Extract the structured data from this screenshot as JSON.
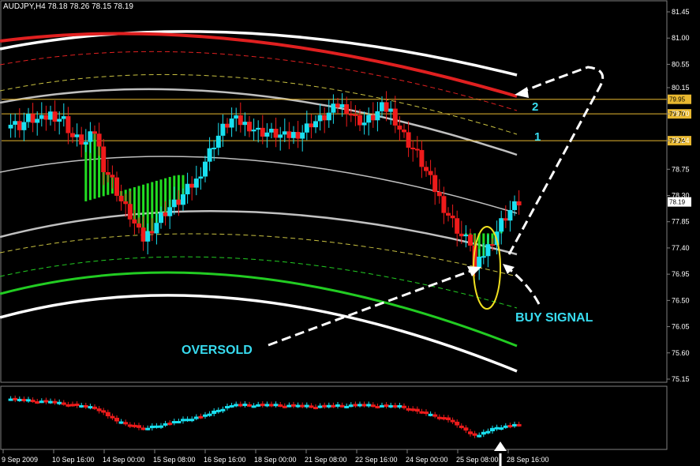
{
  "header": {
    "symbol_info": "AUDJPY,H4",
    "ohlc": "78.18 78.26 78.15 78.19"
  },
  "colors": {
    "background": "#000000",
    "bull": "#19e0f0",
    "bear": "#ee1b1b",
    "fill_green": "#22dd22",
    "level": "#e8b830",
    "band_red": "#e02020",
    "band_green": "#22cc22",
    "band_white": "#ffffff",
    "band_gray": "#c0c0c0",
    "band_yellow": "#c8c040",
    "annotation": "#38dcf0"
  },
  "annotations": {
    "oversold": "OVERSOLD",
    "buy_signal": "BUY SIGNAL",
    "level_1": "1",
    "level_2": "2"
  },
  "chart_data": {
    "type": "candlestick",
    "title": "",
    "symbol": "AUDJPY",
    "timeframe": "H4",
    "y_axis": {
      "ticks": [
        "81.45",
        "81.00",
        "80.55",
        "80.15",
        "79.70",
        "79.24",
        "78.75",
        "78.30",
        "77.85",
        "77.40",
        "76.95",
        "76.50",
        "76.05",
        "75.60",
        "75.15"
      ],
      "range": [
        75.15,
        81.45
      ]
    },
    "x_axis": {
      "labels": [
        "9 Sep 2009",
        "10 Sep 16:00",
        "14 Sep 00:00",
        "15 Sep 08:00",
        "16 Sep 16:00",
        "18 Sep 00:00",
        "21 Sep 08:00",
        "22 Sep 16:00",
        "24 Sep 00:00",
        "25 Sep 08:00",
        "28 Sep 16:00"
      ]
    },
    "levels": [
      {
        "value": 79.95,
        "label": "79.95"
      },
      {
        "value": 79.7,
        "label": "79.70"
      },
      {
        "value": 79.24,
        "label": "79.24"
      }
    ],
    "current_price": {
      "value": 78.19,
      "label": "78.19"
    },
    "close_path": [
      [
        0,
        79.55
      ],
      [
        3,
        79.5
      ],
      [
        5,
        79.62
      ],
      [
        8,
        79.58
      ],
      [
        10,
        79.7
      ],
      [
        13,
        79.6
      ],
      [
        15,
        79.3
      ],
      [
        18,
        79.2
      ],
      [
        20,
        79.4
      ],
      [
        22,
        78.8
      ],
      [
        24,
        78.55
      ],
      [
        26,
        78.2
      ],
      [
        28,
        77.95
      ],
      [
        30,
        77.65
      ],
      [
        31,
        77.55
      ],
      [
        33,
        77.75
      ],
      [
        35,
        77.95
      ],
      [
        37,
        78.1
      ],
      [
        39,
        78.2
      ],
      [
        41,
        78.4
      ],
      [
        43,
        78.55
      ],
      [
        45,
        78.9
      ],
      [
        47,
        79.2
      ],
      [
        49,
        79.45
      ],
      [
        51,
        79.6
      ],
      [
        53,
        79.55
      ],
      [
        55,
        79.5
      ],
      [
        57,
        79.4
      ],
      [
        59,
        79.38
      ],
      [
        61,
        79.35
      ],
      [
        63,
        79.3
      ],
      [
        65,
        79.35
      ],
      [
        67,
        79.4
      ],
      [
        69,
        79.55
      ],
      [
        71,
        79.6
      ],
      [
        73,
        79.7
      ],
      [
        75,
        79.85
      ],
      [
        77,
        79.8
      ],
      [
        79,
        79.62
      ],
      [
        81,
        79.55
      ],
      [
        83,
        79.65
      ],
      [
        85,
        79.8
      ],
      [
        87,
        79.75
      ],
      [
        89,
        79.45
      ],
      [
        91,
        79.2
      ],
      [
        93,
        79.0
      ],
      [
        95,
        78.7
      ],
      [
        97,
        78.4
      ],
      [
        99,
        78.1
      ],
      [
        101,
        77.85
      ],
      [
        103,
        77.6
      ],
      [
        105,
        77.5
      ],
      [
        106,
        77.05
      ],
      [
        107,
        77.15
      ],
      [
        108,
        77.3
      ],
      [
        110,
        77.55
      ],
      [
        112,
        77.85
      ],
      [
        114,
        78.05
      ],
      [
        116,
        78.19
      ]
    ],
    "indicator_path": [
      [
        0,
        0.3
      ],
      [
        10,
        0.2
      ],
      [
        20,
        0.0
      ],
      [
        25,
        -0.45
      ],
      [
        31,
        -0.7
      ],
      [
        37,
        -0.5
      ],
      [
        45,
        -0.25
      ],
      [
        51,
        0.1
      ],
      [
        60,
        0.1
      ],
      [
        70,
        0.05
      ],
      [
        80,
        0.1
      ],
      [
        89,
        0.05
      ],
      [
        100,
        -0.4
      ],
      [
        106,
        -0.95
      ],
      [
        111,
        -0.65
      ],
      [
        116,
        -0.55
      ]
    ]
  }
}
